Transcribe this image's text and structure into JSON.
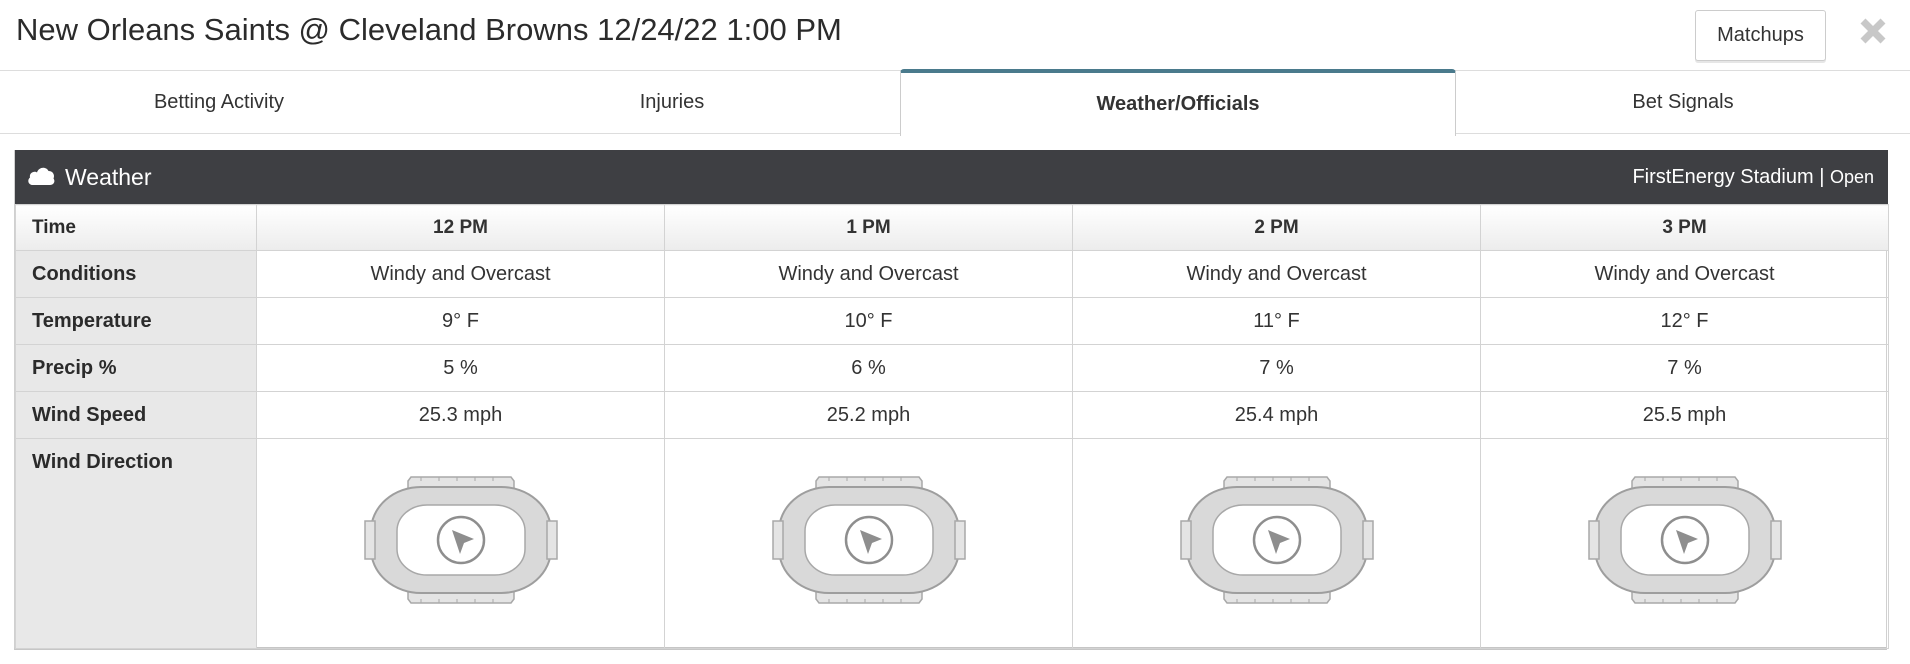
{
  "header": {
    "title": "New Orleans Saints @ Cleveland Browns 12/24/22 1:00 PM",
    "matchups_button": "Matchups",
    "close_icon": "close-x-icon"
  },
  "tabs": [
    {
      "label": "Betting Activity",
      "active": false
    },
    {
      "label": "Injuries",
      "active": false
    },
    {
      "label": "Weather/Officials",
      "active": true
    },
    {
      "label": "Bet Signals",
      "active": false
    }
  ],
  "weather": {
    "title": "Weather",
    "icon": "cloud-icon",
    "stadium": "FirstEnergy Stadium",
    "separator": "|",
    "roof": "Open",
    "labels": {
      "time": "Time",
      "conditions": "Conditions",
      "temperature": "Temperature",
      "precip": "Precip %",
      "wind_speed": "Wind Speed",
      "wind_direction": "Wind Direction"
    },
    "columns": [
      {
        "time": "12 PM",
        "conditions": "Windy and Overcast",
        "temperature": "9° F",
        "precip": "5 %",
        "wind_speed": "25.3 mph",
        "wind_direction_icon": "stadium-wind-arrow-icon"
      },
      {
        "time": "1 PM",
        "conditions": "Windy and Overcast",
        "temperature": "10° F",
        "precip": "6 %",
        "wind_speed": "25.2 mph",
        "wind_direction_icon": "stadium-wind-arrow-icon"
      },
      {
        "time": "2 PM",
        "conditions": "Windy and Overcast",
        "temperature": "11° F",
        "precip": "7 %",
        "wind_speed": "25.4 mph",
        "wind_direction_icon": "stadium-wind-arrow-icon"
      },
      {
        "time": "3 PM",
        "conditions": "Windy and Overcast",
        "temperature": "12° F",
        "precip": "7 %",
        "wind_speed": "25.5 mph",
        "wind_direction_icon": "stadium-wind-arrow-icon"
      }
    ]
  },
  "colors": {
    "panel_header": "#3e3f43",
    "active_tab_accent": "#4a7a8c",
    "label_cell_bg": "#e8e8e8"
  }
}
